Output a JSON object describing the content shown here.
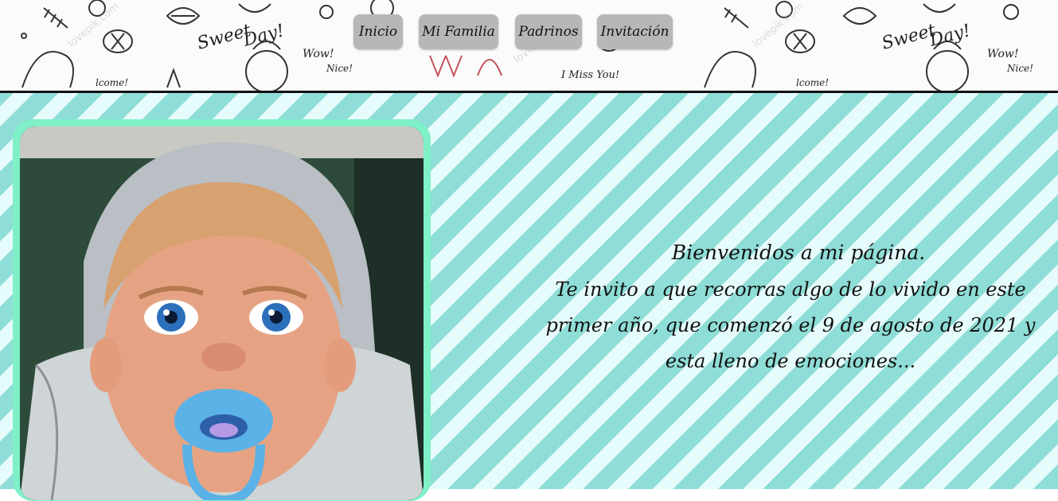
{
  "nav": {
    "items": [
      {
        "label": "Inicio"
      },
      {
        "label": "Mi Familia"
      },
      {
        "label": "Padrinos"
      },
      {
        "label": "Invitación"
      }
    ]
  },
  "welcome": {
    "title": "Bienvenidos a mi página.",
    "body": "Te invito a que recorras algo de lo vivido en este primer año, que comenzó el 9 de agosto de 2021 y esta lleno de emociones..."
  },
  "banner": {
    "doodle_words": [
      "Sweet Day!",
      "Wow!",
      "Nice!",
      "Welcome!",
      "I Miss You!"
    ]
  },
  "colors": {
    "stripe_dark": "#8fddd7",
    "stripe_light": "#e6fbfb",
    "frame": "#7ff0c8",
    "nav_button": "#b9b6b6"
  }
}
